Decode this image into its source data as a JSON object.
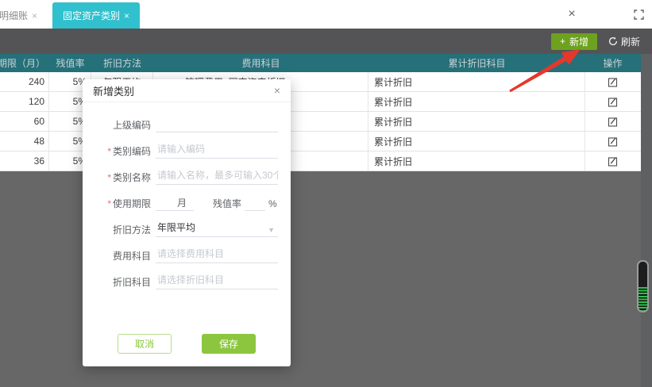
{
  "colors": {
    "active_tab": "#31c0cd",
    "table_header": "#26707a",
    "toolbar_bg": "#545456",
    "add_button_green": "#6da21e",
    "save_button_green": "#8cc63f",
    "arrow_red": "#e5382c",
    "battery_green": "#2fbe4d"
  },
  "icons": {
    "plus": "+",
    "close": "×",
    "caret_down": "▼"
  },
  "tab_bar": {
    "tabs": [
      {
        "label": "明细账",
        "close": "×"
      },
      {
        "label": "固定资产类别",
        "close": "×"
      }
    ],
    "window_close": "×"
  },
  "toolbar": {
    "add_label": "新增",
    "refresh_label": "刷新"
  },
  "table": {
    "columns": [
      "使用期限（月）",
      "残值率",
      "折旧方法",
      "费用科目",
      "累计折旧科目",
      "操作"
    ],
    "rows": [
      {
        "months": "240",
        "residual_rate": "5%",
        "method": "年限平均",
        "expense_account": "管理费用_固定资产折旧",
        "depreciation_account": "累计折旧"
      },
      {
        "months": "120",
        "residual_rate": "5%",
        "method": "",
        "expense_account": "",
        "depreciation_account": "累计折旧"
      },
      {
        "months": "60",
        "residual_rate": "5%",
        "method": "",
        "expense_account": "",
        "depreciation_account": "累计折旧"
      },
      {
        "months": "48",
        "residual_rate": "5%",
        "method": "",
        "expense_account": "",
        "depreciation_account": "累计折旧"
      },
      {
        "months": "36",
        "residual_rate": "5%",
        "method": "",
        "expense_account": "",
        "depreciation_account": "累计折旧"
      }
    ]
  },
  "dialog": {
    "title": "新增类别",
    "close": "×",
    "required_mark": "*",
    "fields": {
      "parent_code": {
        "label": "上级编码",
        "placeholder": ""
      },
      "category_code": {
        "label": "类别编码",
        "placeholder": "请输入编码"
      },
      "category_name": {
        "label": "类别名称",
        "placeholder": "请输入名称，最多可输入30个汉字"
      },
      "useful_life": {
        "label": "使用期限",
        "suffix": "月"
      },
      "residual_rate": {
        "label": "残值率",
        "suffix": "%"
      },
      "method": {
        "label": "折旧方法",
        "value": "年限平均"
      },
      "expense_account": {
        "label": "费用科目",
        "placeholder": "请选择费用科目"
      },
      "depreciation_account": {
        "label": "折旧科目",
        "placeholder": "请选择折旧科目"
      }
    },
    "buttons": {
      "cancel": "取消",
      "save": "保存"
    }
  }
}
